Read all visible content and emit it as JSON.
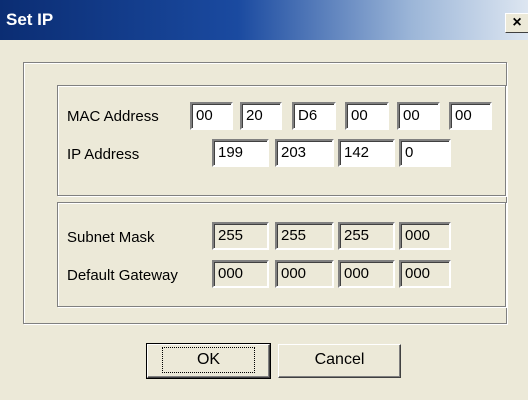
{
  "window": {
    "title": "Set IP",
    "close_glyph": "×"
  },
  "mac": {
    "label": "MAC Address",
    "octets": [
      "00",
      "20",
      "D6",
      "00",
      "00",
      "00"
    ]
  },
  "ip": {
    "label": "IP Address",
    "octets": [
      "199",
      "203",
      "142",
      "0"
    ]
  },
  "subnet": {
    "label": "Subnet Mask",
    "octets": [
      "255",
      "255",
      "255",
      "000"
    ]
  },
  "gateway": {
    "label": "Default Gateway",
    "octets": [
      "000",
      "000",
      "000",
      "000"
    ]
  },
  "buttons": {
    "ok": "OK",
    "cancel": "Cancel"
  }
}
